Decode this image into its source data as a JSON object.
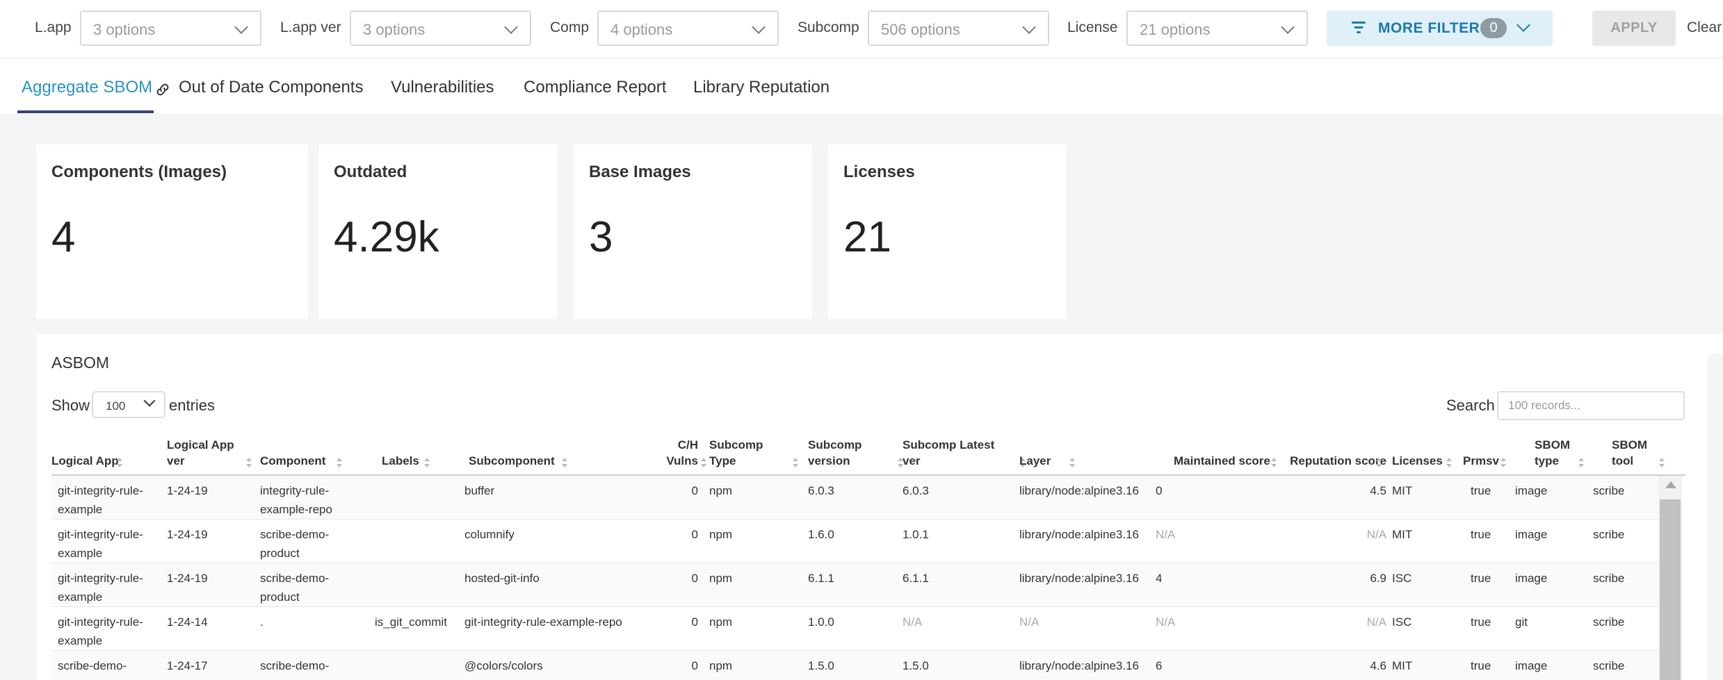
{
  "filters": [
    {
      "label": "L.app",
      "placeholder": "3 options"
    },
    {
      "label": "L.app ver",
      "placeholder": "3 options"
    },
    {
      "label": "Comp",
      "placeholder": "4 options"
    },
    {
      "label": "Subcomp",
      "placeholder": "506 options"
    },
    {
      "label": "License",
      "placeholder": "21 options"
    }
  ],
  "more_filters": {
    "label": "MORE FILTERS",
    "count": "0"
  },
  "apply_label": "APPLY",
  "clear_label": "Clear",
  "tabs": [
    {
      "label": "Aggregate SBOM",
      "active": true
    },
    {
      "label": "Out of Date Components"
    },
    {
      "label": "Vulnerabilities"
    },
    {
      "label": "Compliance Report"
    },
    {
      "label": "Library Reputation"
    }
  ],
  "cards": [
    {
      "title": "Components (Images)",
      "value": "4"
    },
    {
      "title": "Outdated",
      "value": "4.29k"
    },
    {
      "title": "Base Images",
      "value": "3"
    },
    {
      "title": "Licenses",
      "value": "21"
    }
  ],
  "asbom": {
    "title": "ASBOM",
    "show_label": "Show",
    "show_value": "100",
    "entries_label": "entries",
    "search_label": "Search",
    "search_placeholder": "100 records...",
    "columns": [
      "Logical App",
      "Logical App ver",
      "Component",
      "Labels",
      "Subcomponent",
      "C/H Vulns",
      "Subcomp Type",
      "Subcomp version",
      "Subcomp Latest ver",
      "Layer",
      "Maintained score",
      "Reputation score",
      "Licenses",
      "Prmsv",
      "SBOM type",
      "SBOM tool"
    ],
    "rows": [
      [
        "git-integrity-rule-example",
        "1-24-19",
        "integrity-rule-example-repo",
        "",
        "buffer",
        "0",
        "npm",
        "6.0.3",
        "6.0.3",
        "library/node:alpine3.16",
        "0",
        "4.5",
        "MIT",
        "true",
        "image",
        "scribe"
      ],
      [
        "git-integrity-rule-example",
        "1-24-19",
        "scribe-demo-product",
        "",
        "columnify",
        "0",
        "npm",
        "1.6.0",
        "1.0.1",
        "library/node:alpine3.16",
        "N/A",
        "N/A",
        "MIT",
        "true",
        "image",
        "scribe"
      ],
      [
        "git-integrity-rule-example",
        "1-24-19",
        "scribe-demo-product",
        "",
        "hosted-git-info",
        "0",
        "npm",
        "6.1.1",
        "6.1.1",
        "library/node:alpine3.16",
        "4",
        "6.9",
        "ISC",
        "true",
        "image",
        "scribe"
      ],
      [
        "git-integrity-rule-example",
        "1-24-14",
        ".",
        "is_git_commit",
        "git-integrity-rule-example-repo",
        "0",
        "npm",
        "1.0.0",
        "N/A",
        "N/A",
        "N/A",
        "N/A",
        "ISC",
        "true",
        "git",
        "scribe"
      ],
      [
        "scribe-demo-product",
        "1-24-17",
        "scribe-demo-product",
        "",
        "@colors/colors",
        "0",
        "npm",
        "1.5.0",
        "1.5.0",
        "library/node:alpine3.16",
        "6",
        "4.6",
        "MIT",
        "true",
        "image",
        "scribe"
      ]
    ]
  }
}
